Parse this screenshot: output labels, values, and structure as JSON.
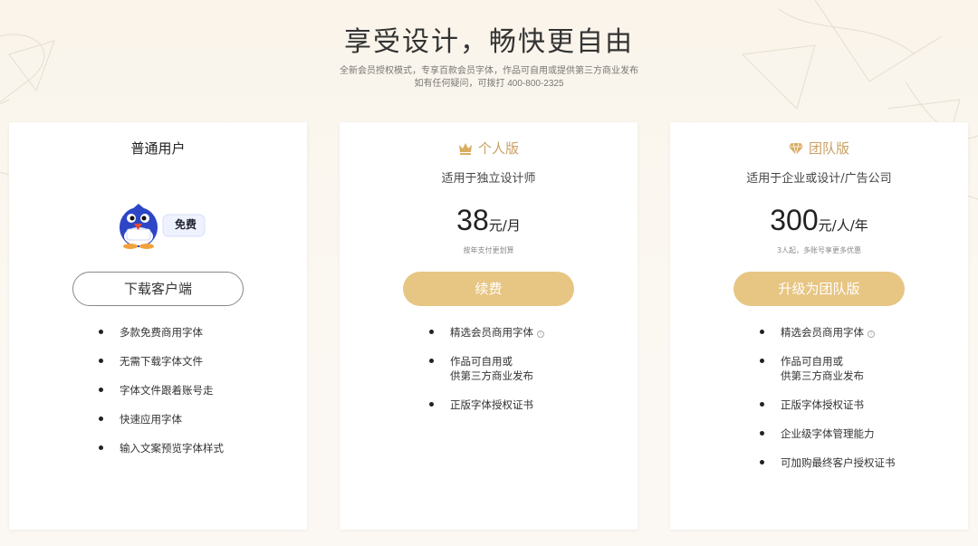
{
  "hero": {
    "title": "享受设计，畅快更自由",
    "subtitle_line1": "全新会员授权模式，专享百款会员字体，作品可自用或提供第三方商业发布",
    "subtitle_line2": "如有任何疑问，可拨打 400-800-2325"
  },
  "plans": {
    "free": {
      "title": "普通用户",
      "badge": "免费",
      "button": "下载客户端",
      "features": [
        "多款免费商用字体",
        "无需下载字体文件",
        "字体文件跟着账号走",
        "快速应用字体",
        "输入文案预览字体样式"
      ]
    },
    "personal": {
      "icon": "crown-icon",
      "title": "个人版",
      "desc": "适用于独立设计师",
      "price": "38",
      "unit": "元/月",
      "note": "按年支付更划算",
      "button": "续费",
      "features": [
        {
          "lines": [
            "精选会员商用字体"
          ],
          "info": "i"
        },
        {
          "lines": [
            "作品可自用或",
            "供第三方商业发布"
          ]
        },
        {
          "lines": [
            "正版字体授权证书"
          ]
        }
      ]
    },
    "team": {
      "icon": "diamond-icon",
      "title": "团队版",
      "desc": "适用于企业或设计/广告公司",
      "price": "300",
      "unit": "元/人/年",
      "note": "3人起，多账号享更多优惠",
      "button": "升级为团队版",
      "features": [
        {
          "lines": [
            "精选会员商用字体"
          ],
          "info": "i"
        },
        {
          "lines": [
            "作品可自用或",
            "供第三方商业发布"
          ]
        },
        {
          "lines": [
            "正版字体授权证书"
          ]
        },
        {
          "lines": [
            "企业级字体管理能力"
          ]
        },
        {
          "lines": [
            "可加购最终客户授权证书"
          ]
        }
      ]
    }
  },
  "colors": {
    "gold": "#c9a063",
    "gold_button": "#e7c583",
    "background": "#fbf8f3"
  }
}
